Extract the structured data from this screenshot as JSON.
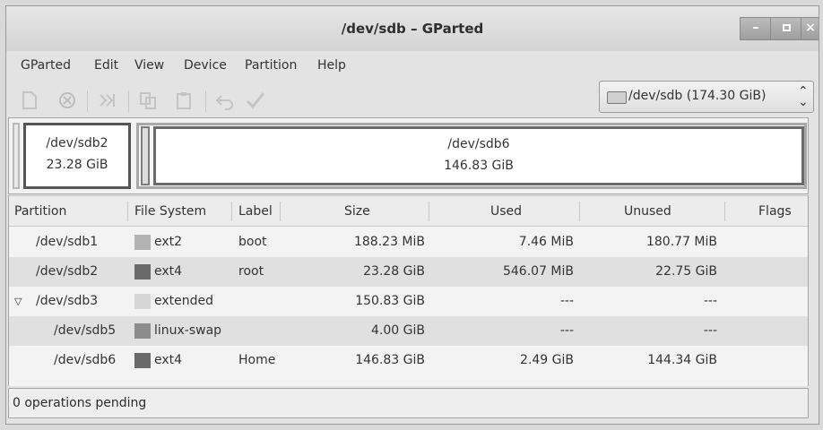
{
  "window": {
    "title": "/dev/sdb – GParted"
  },
  "menubar": {
    "items": [
      "GParted",
      "Edit",
      "View",
      "Device",
      "Partition",
      "Help"
    ]
  },
  "device_selector": {
    "label": "/dev/sdb  (174.30 GiB)"
  },
  "disk_map": {
    "segments": [
      {
        "name": "/dev/sdb2",
        "size": "23.28 GiB"
      },
      {
        "name": "/dev/sdb6",
        "size": "146.83 GiB"
      }
    ]
  },
  "table": {
    "headers": [
      "Partition",
      "File System",
      "Label",
      "Size",
      "Used",
      "Unused",
      "Flags"
    ],
    "rows": [
      {
        "partition": "/dev/sdb1",
        "fs": "ext2",
        "label": "boot",
        "size": "188.23 MiB",
        "used": "7.46 MiB",
        "unused": "180.77 MiB",
        "flags": "",
        "fs_color": "#b3b3b3"
      },
      {
        "partition": "/dev/sdb2",
        "fs": "ext4",
        "label": "root",
        "size": "23.28 GiB",
        "used": "546.07 MiB",
        "unused": "22.75 GiB",
        "flags": "",
        "fs_color": "#6a6a6a"
      },
      {
        "partition": "/dev/sdb3",
        "fs": "extended",
        "label": "",
        "size": "150.83 GiB",
        "used": "---",
        "unused": "---",
        "flags": "",
        "fs_color": "#d6d6d6"
      },
      {
        "partition": "/dev/sdb5",
        "fs": "linux-swap",
        "label": "",
        "size": "4.00 GiB",
        "used": "---",
        "unused": "---",
        "flags": "",
        "fs_color": "#8c8c8c"
      },
      {
        "partition": "/dev/sdb6",
        "fs": "ext4",
        "label": "Home",
        "size": "146.83 GiB",
        "used": "2.49 GiB",
        "unused": "144.34 GiB",
        "flags": "",
        "fs_color": "#6a6a6a"
      }
    ]
  },
  "statusbar": {
    "text": "0 operations pending"
  }
}
